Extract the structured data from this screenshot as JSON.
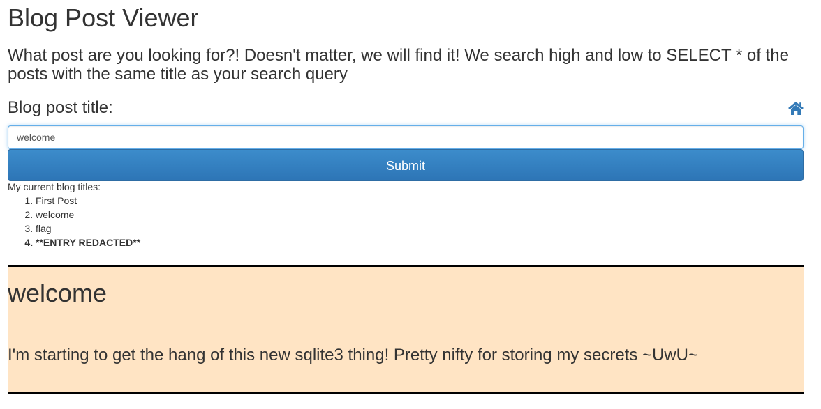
{
  "page": {
    "title": "Blog Post Viewer",
    "intro": "What post are you looking for?! Doesn't matter, we will find it! We search high and low to SELECT * of the posts with the same title as your search query"
  },
  "search": {
    "label": "Blog post title:",
    "value": "welcome",
    "submit_label": "Submit",
    "home_icon": "home-icon"
  },
  "titles": {
    "caption": "My current blog titles:",
    "items": [
      "First Post",
      "welcome",
      "flag",
      "**ENTRY REDACTED**"
    ]
  },
  "post": {
    "title": "welcome",
    "body": "I'm starting to get the hang of this new sqlite3 thing! Pretty nifty for storing my secrets ~UwU~"
  },
  "colors": {
    "accent": "#337ab7",
    "post_background": "#ffe4c4",
    "post_border": "#000000",
    "input_focus": "#66afe9"
  }
}
